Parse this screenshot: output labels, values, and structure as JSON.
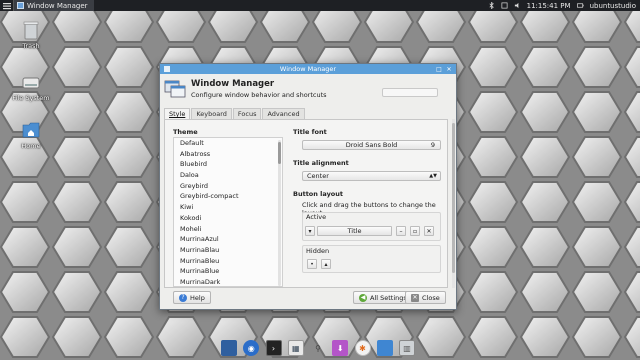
{
  "top_panel": {
    "task_title": "Window Manager",
    "clock": "11:15:41 PM",
    "user": "ubuntustudio"
  },
  "desktop_icons": [
    {
      "label": "Trash",
      "icon": "trash-icon"
    },
    {
      "label": "File System",
      "icon": "drive-icon"
    },
    {
      "label": "Home",
      "icon": "home-folder-icon"
    }
  ],
  "window": {
    "title": "Window Manager",
    "header_title": "Window Manager",
    "header_subtitle": "Configure window behavior and shortcuts",
    "search_placeholder": ""
  },
  "tabs": [
    "Style",
    "Keyboard",
    "Focus",
    "Advanced"
  ],
  "style_tab": {
    "theme_label": "Theme",
    "themes": [
      "Default",
      "Albatross",
      "Bluebird",
      "Daloa",
      "Greybird",
      "Greybird-compact",
      "Kiwi",
      "Kokodi",
      "Moheli",
      "MurrinaAzul",
      "MurrinaBlau",
      "MurrinaBleu",
      "MurrinaBlue",
      "MurrinaDark"
    ],
    "title_font_label": "Title font",
    "title_font_name": "Droid Sans Bold",
    "title_font_size": "9",
    "title_alignment_label": "Title alignment",
    "title_alignment_value": "Center",
    "button_layout_label": "Button layout",
    "button_layout_hint": "Click and drag the buttons to change the layout",
    "active_label": "Active",
    "active_title_button": "Title",
    "hidden_label": "Hidden"
  },
  "footer": {
    "help_label": "Help",
    "all_settings_label": "All Settings",
    "close_label": "Close"
  },
  "dock_items": [
    "desktop-icon",
    "browser-icon",
    "terminal-icon",
    "settings-manager-icon",
    "search-icon",
    "software-center-icon",
    "chat-icon",
    "files-icon",
    "trash-icon"
  ],
  "colors": {
    "titlebar": "#5b9fd9",
    "panel_bg": "#1e2024",
    "window_bg": "#eeeeec"
  }
}
